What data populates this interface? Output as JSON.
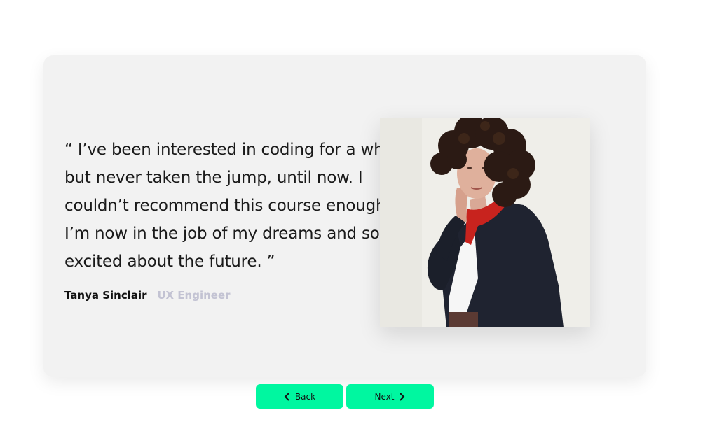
{
  "testimonial": {
    "quote": "“ I’ve been interested in coding for a while but never taken the jump, until now. I couldn’t recommend this course enough. I’m now in the job of my dreams and so excited about the future. ”",
    "author_name": "Tanya Sinclair",
    "author_role": "UX Engineer"
  },
  "navigation": {
    "back_label": "Back",
    "next_label": "Next",
    "back_icon": "chevron-left-icon",
    "next_icon": "chevron-right-icon"
  },
  "colors": {
    "button_bg": "#00f7a0",
    "card_bg": "#f2f2f2",
    "role_text": "#c3c3d3"
  }
}
